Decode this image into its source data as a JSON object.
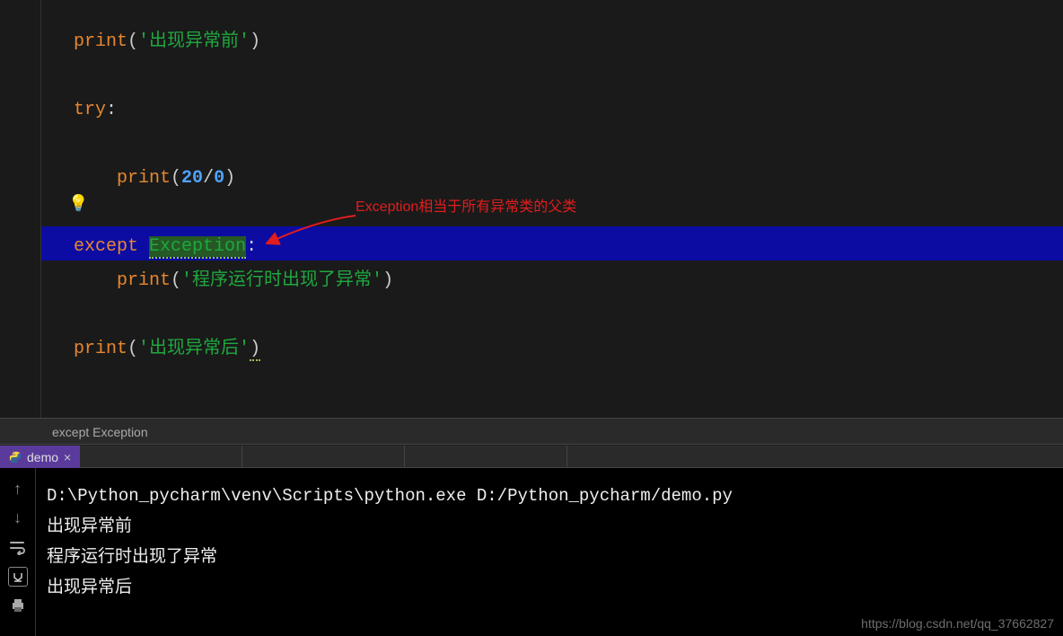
{
  "code": {
    "print_before": {
      "fn": "print",
      "str": "'出现异常前'"
    },
    "try_kw": "try",
    "print_inside": {
      "fn": "print",
      "num1": "20",
      "op": "/",
      "num2": "0"
    },
    "except_kw": "except",
    "exception_class": "Exception",
    "print_catch": {
      "fn": "print",
      "str": "'程序运行时出现了异常'"
    },
    "print_after": {
      "fn": "print",
      "str": "'出现异常后'"
    }
  },
  "annotation": {
    "text": "Exception相当于所有异常类的父类"
  },
  "breadcrumb": {
    "text": "except Exception"
  },
  "run_tab": {
    "label": "demo",
    "close": "×"
  },
  "tool_gutter": {
    "up": "↑",
    "down": "↓"
  },
  "console": {
    "line1": "D:\\Python_pycharm\\venv\\Scripts\\python.exe D:/Python_pycharm/demo.py",
    "line2": "出现异常前",
    "line3": "程序运行时出现了异常",
    "line4": "出现异常后"
  },
  "watermark": "https://blog.csdn.net/qq_37662827"
}
